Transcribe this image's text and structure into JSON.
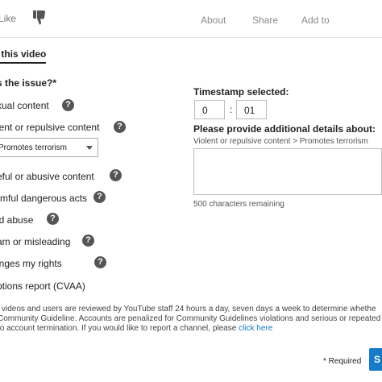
{
  "topbar": {
    "like_label": "Like",
    "dislike_icon": "thumbs-down-icon",
    "tabs": [
      "About",
      "Share",
      "Add to"
    ]
  },
  "report": {
    "heading": "t this video",
    "question": "s the issue?*",
    "options": [
      "xual content",
      "lent or repulsive content",
      "eful or abusive content",
      "rmful dangerous acts",
      "ld abuse",
      "am or misleading",
      "inges my rights",
      "ptions report (CVAA)"
    ],
    "help_glyph": "?",
    "select_value": "Promotes terrorism"
  },
  "timestamp": {
    "label": "Timestamp selected:",
    "minutes": "0",
    "seconds": "01",
    "separator": ":"
  },
  "details": {
    "label": "Please provide additional details about:",
    "path": "Violent or repulsive content > Promotes terrorism",
    "remaining": "500 characters remaining"
  },
  "footer": {
    "line1": "l videos and users are reviewed by YouTube staff 24 hours a day, seven days a week to determine whethe",
    "line2": "Community Guideline. Accounts are penalized for Community Guidelines violations and serious or repeated",
    "line3": "to account termination. If you would like to report a channel, please",
    "link": "click here"
  },
  "actions": {
    "required": "* Required",
    "submit": "S"
  },
  "colors": {
    "accent": "#167ac6",
    "help_bg": "#555555"
  }
}
